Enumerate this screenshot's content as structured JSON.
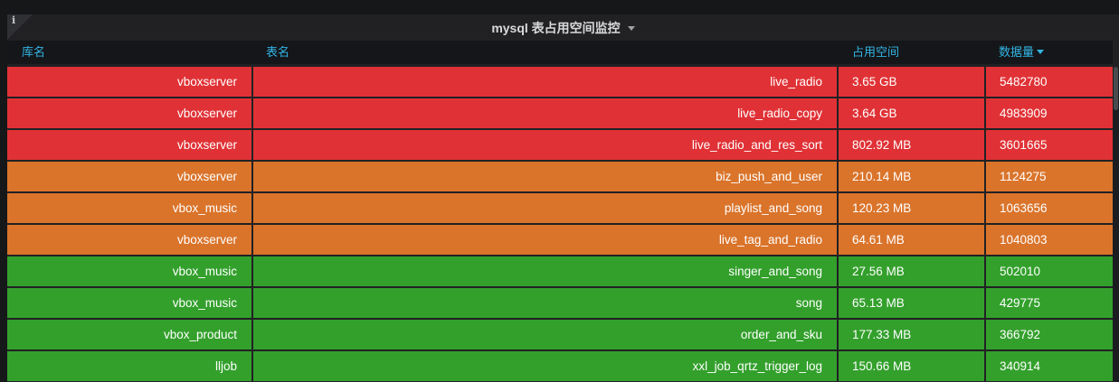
{
  "panel": {
    "title": "mysql 表占用空间监控",
    "info_icon": "info-icon",
    "title_menu_icon": "chevron-down-icon"
  },
  "columns": {
    "db": "库名",
    "table": "表名",
    "size": "占用空间",
    "rows": "数据量"
  },
  "sort": {
    "column": "数据量",
    "direction": "desc",
    "icon": "sort-desc-icon"
  },
  "colors": {
    "red": "#e03236",
    "orange": "#da742b",
    "green": "#33a02c",
    "header_text": "#33b5e5"
  },
  "rows": [
    {
      "db": "vboxserver",
      "table": "live_radio",
      "size": "3.65 GB",
      "rows": "5482780",
      "level": "red"
    },
    {
      "db": "vboxserver",
      "table": "live_radio_copy",
      "size": "3.64 GB",
      "rows": "4983909",
      "level": "red"
    },
    {
      "db": "vboxserver",
      "table": "live_radio_and_res_sort",
      "size": "802.92 MB",
      "rows": "3601665",
      "level": "red"
    },
    {
      "db": "vboxserver",
      "table": "biz_push_and_user",
      "size": "210.14 MB",
      "rows": "1124275",
      "level": "orange"
    },
    {
      "db": "vbox_music",
      "table": "playlist_and_song",
      "size": "120.23 MB",
      "rows": "1063656",
      "level": "orange"
    },
    {
      "db": "vboxserver",
      "table": "live_tag_and_radio",
      "size": "64.61 MB",
      "rows": "1040803",
      "level": "orange"
    },
    {
      "db": "vbox_music",
      "table": "singer_and_song",
      "size": "27.56 MB",
      "rows": "502010",
      "level": "green"
    },
    {
      "db": "vbox_music",
      "table": "song",
      "size": "65.13 MB",
      "rows": "429775",
      "level": "green"
    },
    {
      "db": "vbox_product",
      "table": "order_and_sku",
      "size": "177.33 MB",
      "rows": "366792",
      "level": "green"
    },
    {
      "db": "lljob",
      "table": "xxl_job_qrtz_trigger_log",
      "size": "150.66 MB",
      "rows": "340914",
      "level": "green"
    }
  ]
}
